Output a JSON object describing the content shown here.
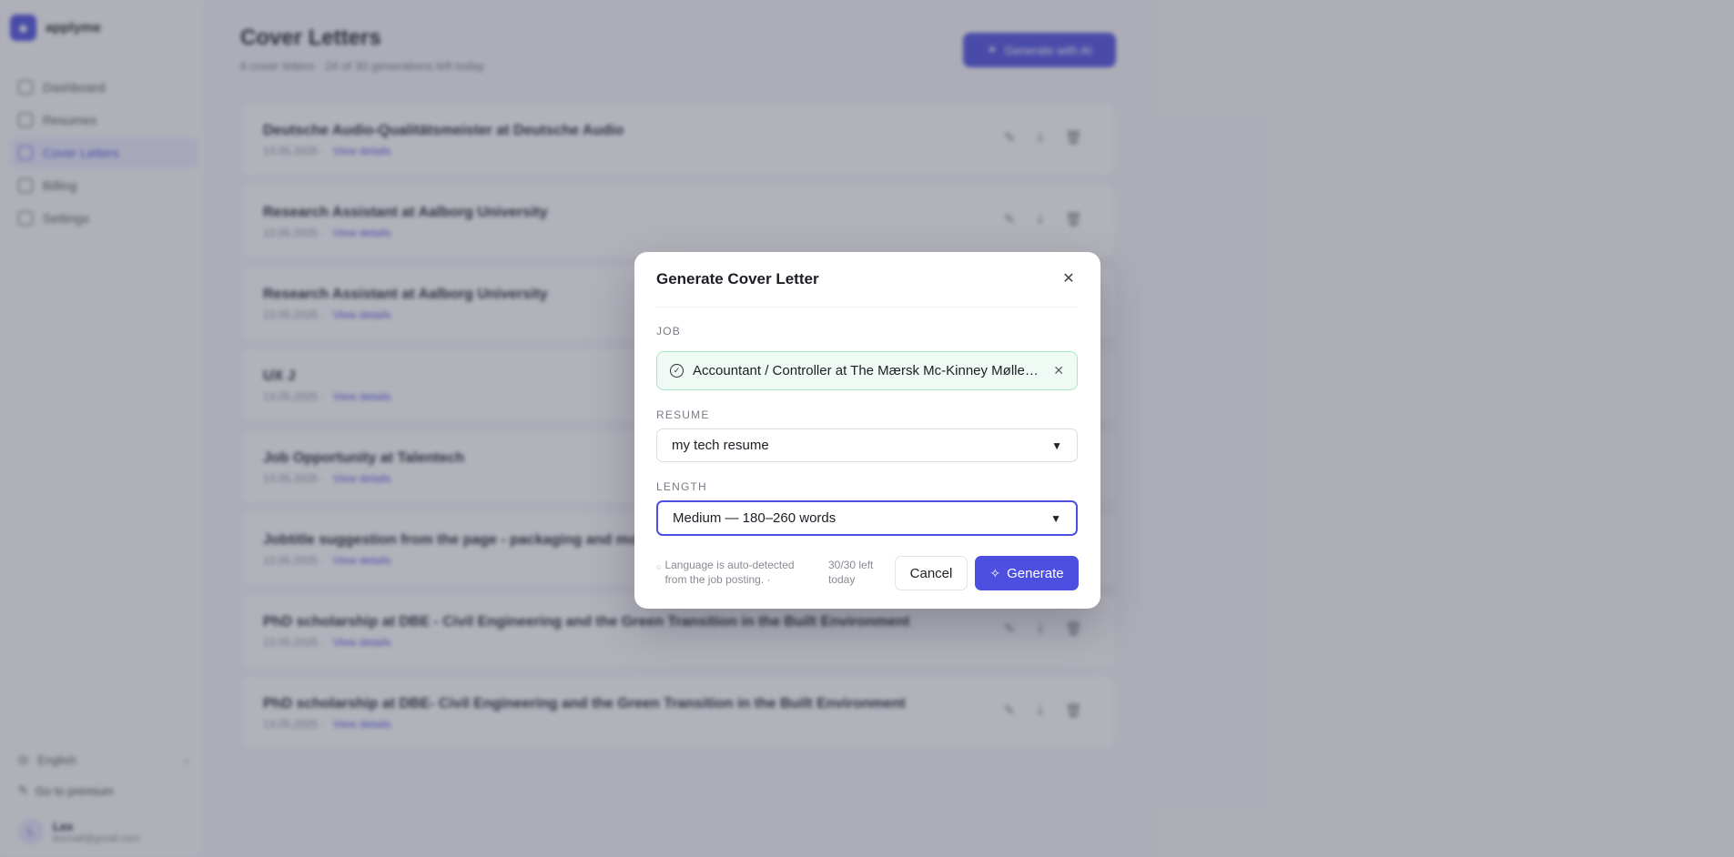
{
  "colors": {
    "accent": "#4c4fe0",
    "job_chip_bg": "#effaf4",
    "job_chip_border": "#a7e6c9"
  },
  "sidebar": {
    "brand": "applyme",
    "nav": [
      {
        "label": "Dashboard",
        "icon": "grid-icon"
      },
      {
        "label": "Resumes",
        "icon": "user-icon"
      },
      {
        "label": "Cover Letters",
        "icon": "document-icon"
      },
      {
        "label": "Billing",
        "icon": "credit-card-icon"
      },
      {
        "label": "Settings",
        "icon": "gear-icon"
      }
    ],
    "language": "English",
    "upgrade": "Go to premium",
    "user": {
      "name": "Lex",
      "email": "lexmail@gmail.com",
      "initial": "L"
    }
  },
  "main": {
    "title": "Cover Letters",
    "subtitle": "6 cover letters · 24 of 30 generations left today",
    "new_button": "Generate with AI",
    "letters": [
      {
        "title": "Deutsche Audio-Qualitätsmeister at Deutsche Audio",
        "date": "13.05.2025",
        "link": "View details"
      },
      {
        "title": "Research Assistant at Aalborg University",
        "date": "13.05.2025",
        "link": "View details"
      },
      {
        "title": "Research Assistant at Aalborg University",
        "date": "13.05.2025",
        "link": "View details"
      },
      {
        "title": "UX J",
        "date": "13.05.2025",
        "link": "View details"
      },
      {
        "title": "Job Opportunity at Talentech",
        "date": "13.05.2025",
        "link": "View details"
      },
      {
        "title": "Jobtitle suggestion from the page - packaging and more",
        "date": "13.05.2025",
        "link": "View details"
      },
      {
        "title": "PhD scholarship at DBE - Civil Engineering and the Green Transition in the Built Environment",
        "date": "13.05.2025",
        "link": "View details"
      },
      {
        "title": "PhD scholarship at DBE- Civil Engineering and the Green Transition in the Built Environment",
        "date": "13.05.2025",
        "link": "View details"
      }
    ]
  },
  "modal": {
    "title": "Generate Cover Letter",
    "job_label": "JOB",
    "job_value": "Accountant / Controller at The Mærsk Mc-Kinney Møller Center for Zero Carbon Shipping",
    "resume_label": "RESUME",
    "resume_value": "my tech resume",
    "length_label": "LENGTH",
    "length_value": "Medium — 180–260 words",
    "note": "Language is auto-detected from the job posting. ·",
    "quota": "30/30 left today",
    "cancel": "Cancel",
    "generate": "Generate"
  }
}
